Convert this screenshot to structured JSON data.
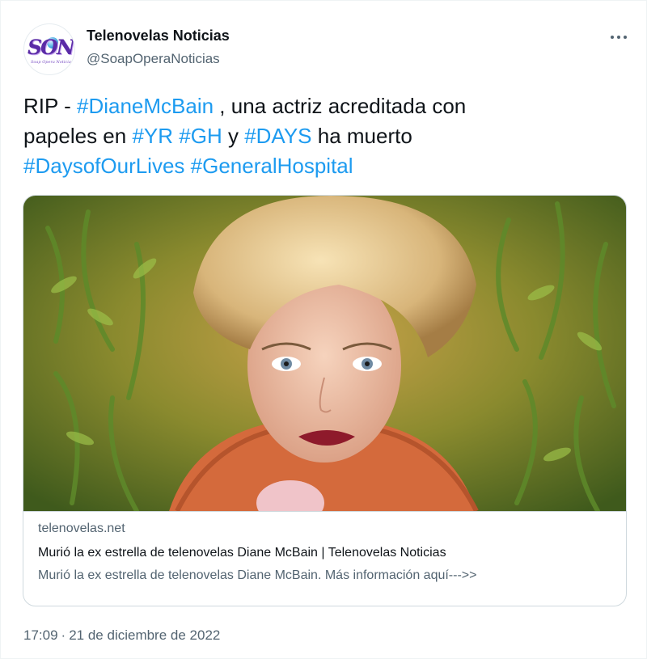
{
  "tweet": {
    "author": {
      "display_name": "Telenovelas Noticias",
      "handle": "@SoapOperaNoticias",
      "avatar": {
        "logo_text": "SON",
        "tagline": "Soap Opera Noticias"
      }
    },
    "more_icon": "more-horizontal-icon",
    "text": {
      "line1_prefix": "RIP - ",
      "hashtag_dianemcbain": "#DianeMcBain",
      "line1_suffix": " , una actriz acreditada con",
      "line2_prefix": "papeles en ",
      "hashtag_yr": "#YR",
      "space": " ",
      "hashtag_gh": "#GH",
      "conj": " y ",
      "hashtag_days": "#DAYS",
      "line2_suffix": " ha muerto",
      "hashtag_daysofourlives": "#DaysofOurLives",
      "hashtag_generalhospital": "#GeneralHospital"
    },
    "card": {
      "domain": "telenovelas.net",
      "title": "Murió la ex estrella de telenovelas Diane McBain | Telenovelas Noticias",
      "description": "Murió la ex estrella de telenovelas Diane McBain. Más información aquí--->>"
    },
    "time": "17:09",
    "separator": "·",
    "date": "21 de diciembre de 2022"
  },
  "colors": {
    "link": "#1d9bf0",
    "text": "#0f1419",
    "secondary": "#536471",
    "border": "#cfd9de"
  }
}
